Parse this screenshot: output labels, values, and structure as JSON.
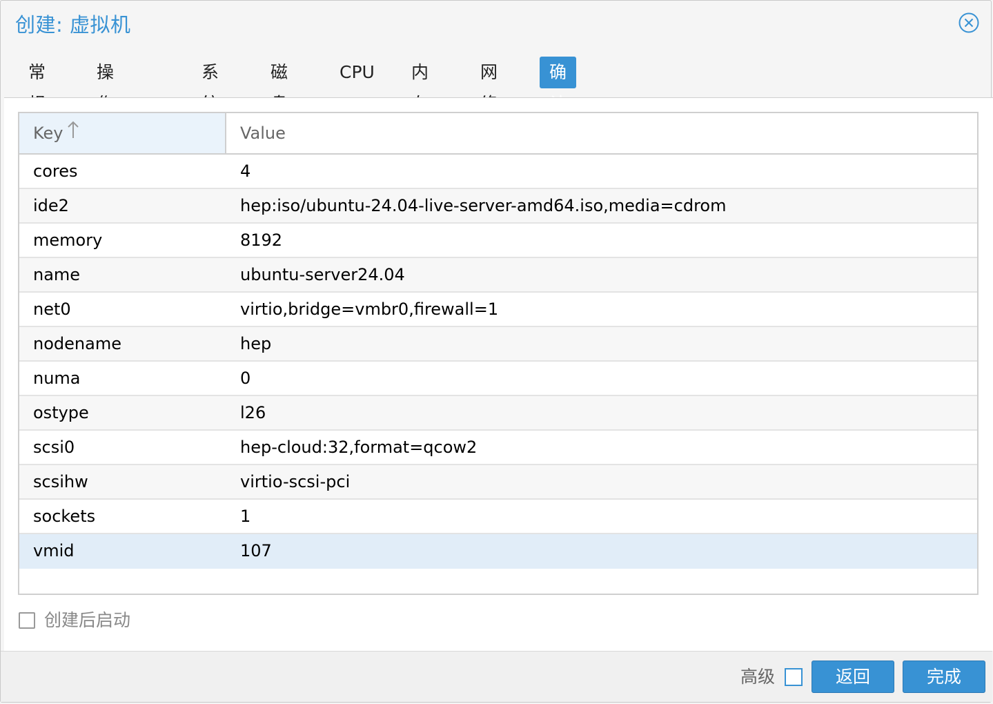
{
  "dialog": {
    "title": "创建: 虚拟机",
    "close_icon": "close-circle-icon"
  },
  "tabs": [
    {
      "label": "常规"
    },
    {
      "label": "操作系统"
    },
    {
      "label": "系统"
    },
    {
      "label": "磁盘"
    },
    {
      "label": "CPU"
    },
    {
      "label": "内存"
    },
    {
      "label": "网络"
    },
    {
      "label": "确认",
      "active": true
    }
  ],
  "grid": {
    "columns": {
      "key": "Key",
      "value": "Value"
    },
    "sort": {
      "column": "Key",
      "direction": "ascending",
      "icon": "sort-up-arrow-icon"
    },
    "rows": [
      {
        "key": "cores",
        "value": "4"
      },
      {
        "key": "ide2",
        "value": "hep:iso/ubuntu-24.04-live-server-amd64.iso,media=cdrom"
      },
      {
        "key": "memory",
        "value": "8192"
      },
      {
        "key": "name",
        "value": "ubuntu-server24.04"
      },
      {
        "key": "net0",
        "value": "virtio,bridge=vmbr0,firewall=1"
      },
      {
        "key": "nodename",
        "value": "hep"
      },
      {
        "key": "numa",
        "value": "0"
      },
      {
        "key": "ostype",
        "value": "l26"
      },
      {
        "key": "scsi0",
        "value": "hep-cloud:32,format=qcow2"
      },
      {
        "key": "scsihw",
        "value": "virtio-scsi-pci"
      },
      {
        "key": "sockets",
        "value": "1"
      },
      {
        "key": "vmid",
        "value": "107",
        "selected": true
      }
    ]
  },
  "options": {
    "start_after_create": {
      "label": "创建后启动",
      "checked": false
    }
  },
  "footer": {
    "advanced_label": "高级",
    "advanced_checked": false,
    "back_label": "返回",
    "finish_label": "完成"
  },
  "colors": {
    "accent": "#3892d4",
    "selected_row": "#e1edf8",
    "sorted_header": "#eaf3fb"
  }
}
